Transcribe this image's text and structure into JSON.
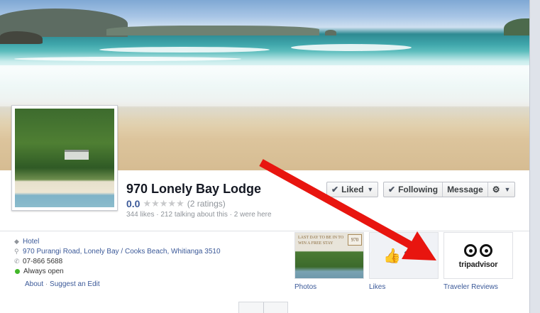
{
  "page": {
    "name": "970 Lonely Bay Lodge",
    "rating": "0.0",
    "rating_count": "(2 ratings)",
    "stars": "★★★★★",
    "stats": "344 likes · 212 talking about this · 2 were here"
  },
  "actions": {
    "liked": "Liked",
    "following": "Following",
    "message": "Message",
    "gear": "⚙"
  },
  "about": {
    "category": "Hotel",
    "address": "970 Purangi Road, Lonely Bay / Cooks Beach, Whitianga 3510",
    "phone": "07-866 5688",
    "hours": "Always open",
    "about_link": "About",
    "separator": "·",
    "suggest_link": "Suggest an Edit"
  },
  "apps": {
    "photos_label": "Photos",
    "photos_thumb_text": "LAST DAY TO BE IN TO WIN A FREE STAY",
    "photos_badge": "970",
    "likes_label": "Likes",
    "likes_count": "344",
    "reviews_label": "Traveler Reviews",
    "tripadvisor_word": "tripadvisor"
  },
  "colors": {
    "link": "#3b5998",
    "arrow": "#e8150f",
    "open_status": "#42b72a"
  },
  "icons": {
    "category": "tag-icon",
    "address": "map-pin-icon",
    "phone": "phone-icon",
    "hours": "status-dot-icon",
    "liked": "check-icon",
    "following": "check-icon",
    "likes": "thumbs-up-icon",
    "reviews": "tripadvisor-owl-icon"
  }
}
